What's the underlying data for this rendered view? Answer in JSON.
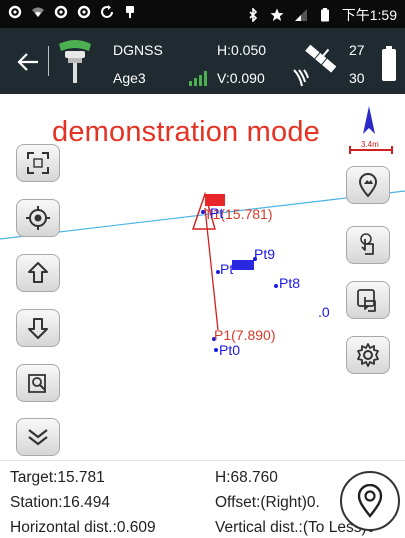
{
  "status_bar": {
    "time": "下午1:59",
    "left_icons": [
      "settings-icon",
      "wifi-icon",
      "settings-icon",
      "settings-icon",
      "sync-icon",
      "pin-icon"
    ],
    "right_icons": [
      "bluetooth-icon",
      "star-icon",
      "cell-signal-icon",
      "battery-icon"
    ]
  },
  "toolbar": {
    "solution": "DGNSS",
    "age": "Age3",
    "h_precision": "H:0.050",
    "v_precision": "V:0.090",
    "sats_used": "27",
    "sats_tracked": "30"
  },
  "map": {
    "mode_label": "demonstration mode",
    "scale_label": "3.4m",
    "target_label": "T1(15.781)",
    "start_label": "P1(7.890)",
    "points": [
      {
        "name": "Pt9"
      },
      {
        "name": "Pt"
      },
      {
        "name": "Pt8"
      },
      {
        "name": ".0"
      },
      {
        "name": "Pt0"
      },
      {
        "name": "Pt"
      }
    ],
    "left_buttons": [
      "fullscreen-icon",
      "crosshair-icon",
      "arrow-up-icon",
      "arrow-down-icon",
      "map-search-icon",
      "double-chevron-down-icon"
    ],
    "right_buttons": [
      "map-layer-icon",
      "tap-icon",
      "select-icon",
      "gear-icon"
    ]
  },
  "info": {
    "target": "Target:15.781",
    "h": "H:68.760",
    "station": "Station:16.494",
    "offset": "Offset:(Right)0.",
    "horizontal": "Horizontal dist.:0.609",
    "vertical": "Vertical dist.:(To Less)0"
  },
  "colors": {
    "toolbar_bg": "#1f2b31",
    "status_bg": "#0b0b0b",
    "accent_green": "#4caf50",
    "demo_red": "#e53222",
    "point_blue": "#1a1ae6",
    "line_blue": "#4ab4e6"
  }
}
